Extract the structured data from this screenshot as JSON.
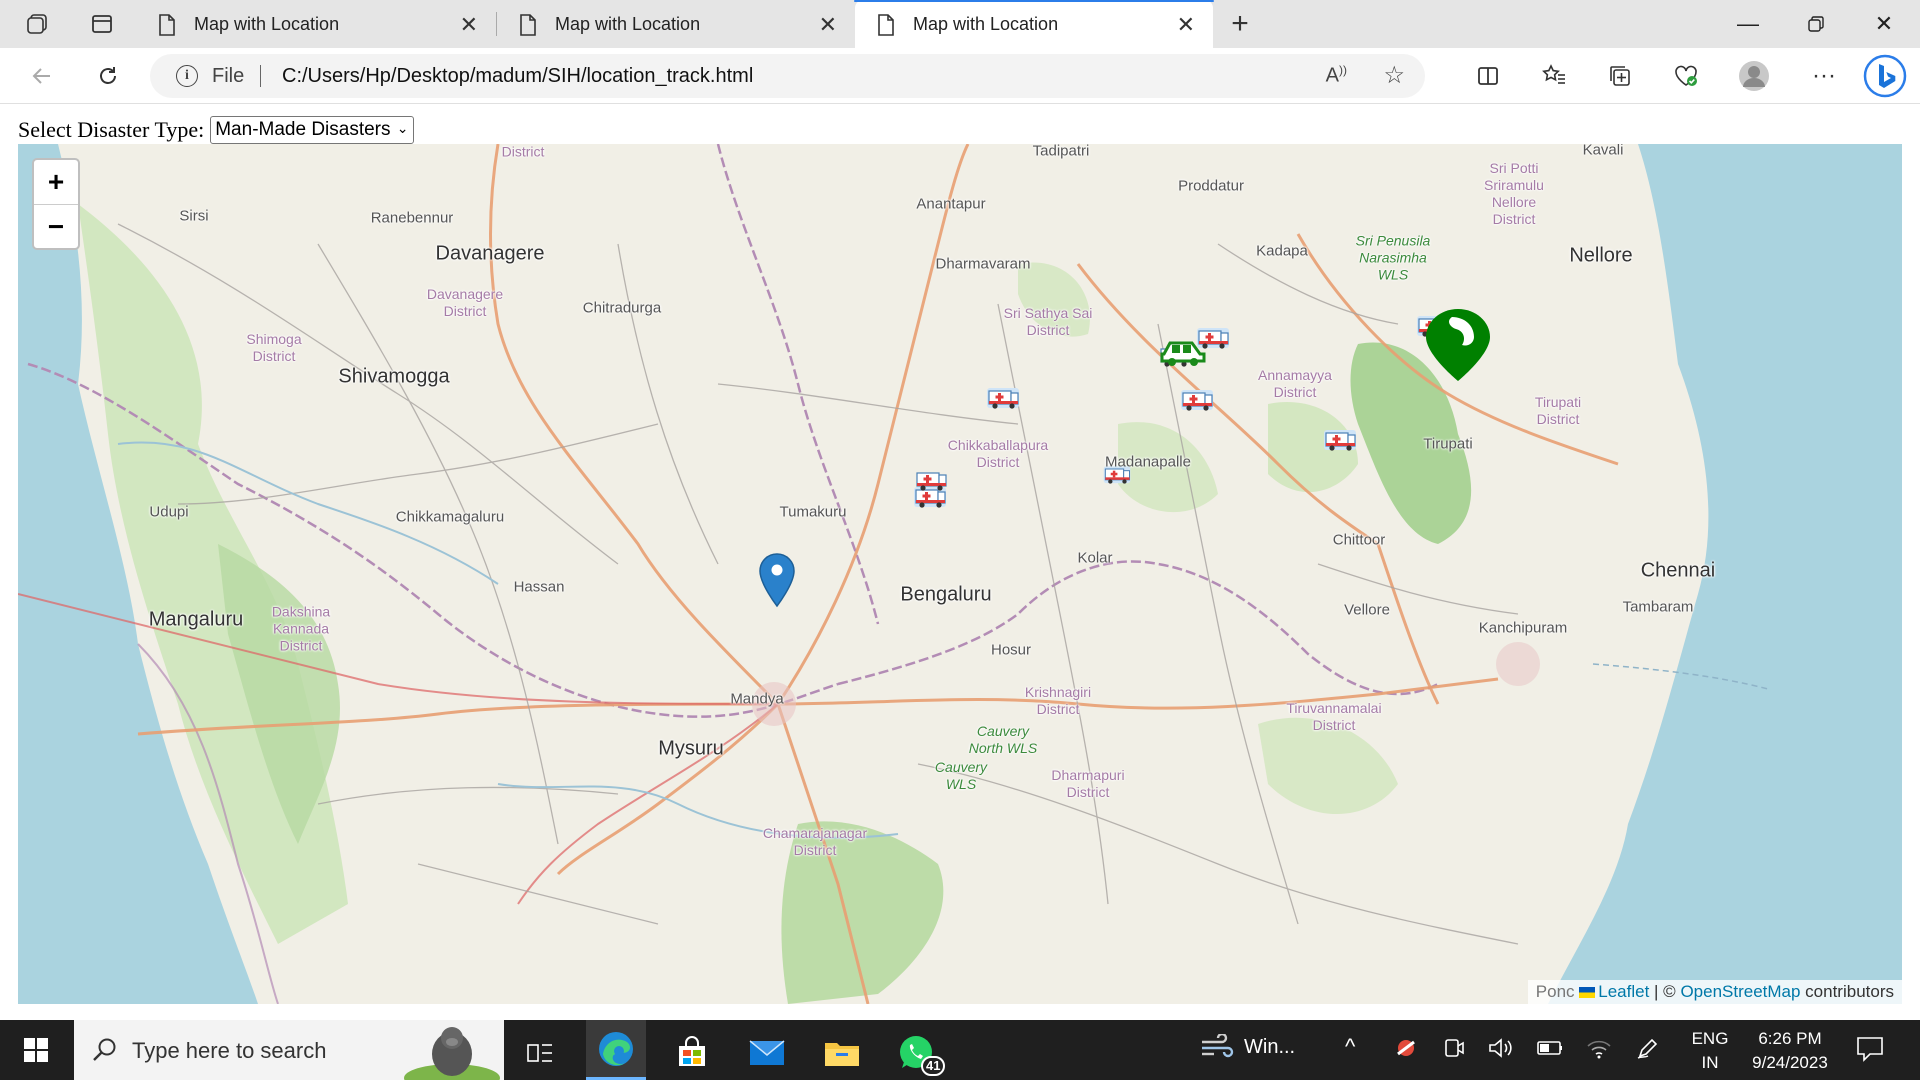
{
  "browser": {
    "tabs": [
      {
        "title": "Map with Location",
        "active": false
      },
      {
        "title": "Map with Location",
        "active": false
      },
      {
        "title": "Map with Location",
        "active": true
      }
    ],
    "address": {
      "scheme": "File",
      "url": "C:/Users/Hp/Desktop/madum/SIH/location_track.html"
    }
  },
  "page": {
    "disaster_label": "Select Disaster Type:",
    "disaster_selected": "Man-Made Disasters",
    "zoom_in": "+",
    "zoom_out": "−",
    "attribution": {
      "leaflet": "Leaflet",
      "separator": " | © ",
      "osm": "OpenStreetMap",
      "suffix": " contributors",
      "cut_label": "Ponc"
    },
    "places": {
      "tadipatri": "Tadipatri",
      "kavali": "Kavali",
      "proddatur": "Proddatur",
      "anantapur": "Anantapur",
      "sirsi": "Sirsi",
      "ranebennur": "Ranebennur",
      "davanagere": "Davanagere",
      "dharmavaram": "Dharmavaram",
      "kadapa": "Kadapa",
      "nellore": "Nellore",
      "chitradurga": "Chitradurga",
      "shivamogga": "Shivamogga",
      "madanapalle": "Madanapalle",
      "tirupati": "Tirupati",
      "udupi": "Udupi",
      "chikkamagaluru": "Chikkamagaluru",
      "tumakuru": "Tumakuru",
      "chittoor": "Chittoor",
      "kolar": "Kolar",
      "hassan": "Hassan",
      "bengaluru": "Bengaluru",
      "chennai": "Chennai",
      "mangaluru": "Mangaluru",
      "vellore": "Vellore",
      "tambaram": "Tambaram",
      "kanchipuram": "Kanchipuram",
      "hosur": "Hosur",
      "mandya": "Mandya",
      "mysuru": "Mysuru"
    },
    "districts": {
      "district_top": "District",
      "sri_potti": "Sri Potti Sriramulu Nellore District",
      "davanagere_d": "Davanagere District",
      "shimoga_d": "Shimoga District",
      "sathya_sai_d": "Sri Sathya Sai District",
      "annamayya_d": "Annamayya District",
      "tirupati_d": "Tirupati District",
      "chikkaballapura_d": "Chikkaballapura District",
      "dakshina_d": "Dakshina Kannada District",
      "krishnagiri_d": "Krishnagiri District",
      "tiruvannamalai_d": "Tiruvannamalai District",
      "dharmapuri_d": "Dharmapuri District",
      "chamarajanagar_d": "Chamarajanagar District"
    },
    "parks": {
      "penusila": "Sri Penusila Narasimha WLS",
      "cauvery_north": "Cauvery North WLS",
      "cauvery": "Cauvery WLS"
    },
    "markers": {
      "location_pin_color": "#2a81cb",
      "destination_pin_color": "#008000",
      "ambulance_count": 9
    }
  },
  "taskbar": {
    "search_placeholder": "Type here to search",
    "weather_label": "Win...",
    "whatsapp_badge": "41",
    "lang_top": "ENG",
    "lang_bottom": "IN",
    "time": "6:26 PM",
    "date": "9/24/2023"
  }
}
